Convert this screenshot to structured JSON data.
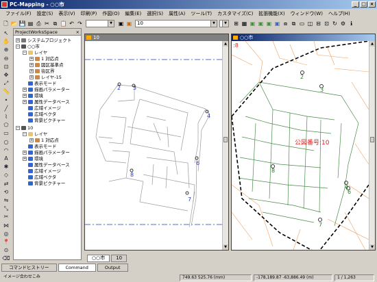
{
  "window": {
    "title": "PC-Mapping - ○○市"
  },
  "menu": [
    "ファイル(F)",
    "設定(S)",
    "表示(V)",
    "印刷(P)",
    "作図(O)",
    "編集(E)",
    "選択(S)",
    "属性(A)",
    "ツール(T)",
    "カスタマイズ(C)",
    "拡張機能(X)",
    "ウィンドウ(W)",
    "ヘルプ(H)"
  ],
  "toolbar": {
    "combo1": "",
    "combo2": "10",
    "combo3": ""
  },
  "workspace": {
    "title": "ProjectWorksSpace",
    "tree": [
      "システムプロジェクト",
      "○○市",
      "レイヤ",
      "1 対応点",
      "図区基準点",
      "街区界",
      "レイヤ-15",
      "表示モード",
      "描画パラメーター",
      "環境",
      "属性データベース",
      "広域イメージ",
      "広域ベクタ",
      "背景ピクチャー",
      "10",
      "レイヤ",
      "1 対応点",
      "表示モード",
      "描画パラメーター",
      "環境",
      "属性データベース",
      "広域イメージ",
      "広域ベクタ",
      "背景ピクチャー"
    ]
  },
  "docs": {
    "left": {
      "title": "10",
      "points": [
        "2",
        "3",
        "4",
        "8",
        "6",
        "7"
      ]
    },
    "right": {
      "title": "○○市",
      "edge_label": ":8",
      "points": [
        "2",
        "3",
        "4",
        "8",
        "6",
        "7"
      ],
      "annotation": "公図番号:10"
    }
  },
  "doc_tabs": [
    "○○市",
    "10"
  ],
  "panel_tabs": [
    "コマンドヒストリー",
    "Command",
    "Output"
  ],
  "status": {
    "mode": "イメージ合わせこみ",
    "coords": "749.63 525.76 (mm)",
    "world": "-178,189.87 -63,886.49 (m)",
    "page": "1 / 1,263"
  },
  "colors": {
    "title_start": "#0a246a",
    "title_end": "#a6caf0",
    "parcel": "#4a8a4a",
    "parcel_orange": "#f0a060",
    "point": "#2233cc",
    "annotation": "#e02020",
    "boundary": "#5566cc"
  }
}
